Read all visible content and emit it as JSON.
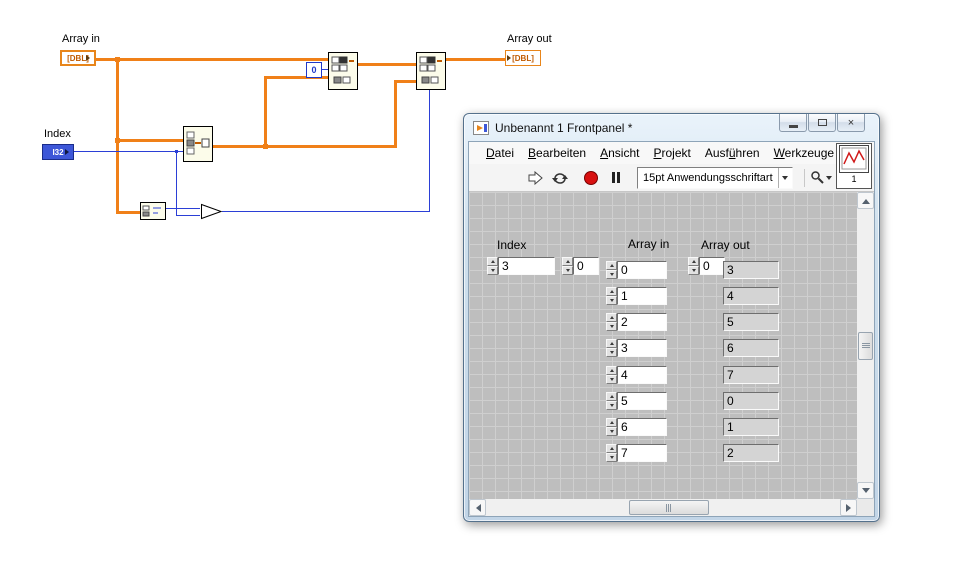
{
  "block_diagram": {
    "labels": {
      "array_in": "Array in",
      "index": "Index",
      "array_out": "Array out"
    },
    "terminals": {
      "array_in": "[DBL]",
      "index": "I32",
      "array_out": "[DBL]"
    },
    "constant_zero": "0",
    "colors": {
      "array_wire": "#F08018",
      "int_wire": "#2B3FD6"
    }
  },
  "window": {
    "title": "Unbenannt 1 Frontpanel *",
    "chrome": {
      "close_glyph": "×"
    },
    "menu": {
      "items": [
        {
          "pre": "",
          "accel": "D",
          "post": "atei"
        },
        {
          "pre": "",
          "accel": "B",
          "post": "earbeiten"
        },
        {
          "pre": "",
          "accel": "A",
          "post": "nsicht"
        },
        {
          "pre": "",
          "accel": "P",
          "post": "rojekt"
        },
        {
          "pre": "Ausf",
          "accel": "ü",
          "post": "hren"
        },
        {
          "pre": "",
          "accel": "W",
          "post": "erkzeuge"
        }
      ]
    },
    "toolbar": {
      "font_selector": "15pt Anwendungsschriftart",
      "help_glyph": "?",
      "vi_icon_badge": "1"
    },
    "panel": {
      "index_control": {
        "label": "Index",
        "value": "3"
      },
      "array_in": {
        "label": "Array in",
        "index_value": "0",
        "values": [
          "0",
          "1",
          "2",
          "3",
          "4",
          "5",
          "6",
          "7"
        ]
      },
      "array_out": {
        "label": "Array out",
        "index_value": "0",
        "values": [
          "3",
          "4",
          "5",
          "6",
          "7",
          "0",
          "1",
          "2"
        ]
      }
    }
  }
}
